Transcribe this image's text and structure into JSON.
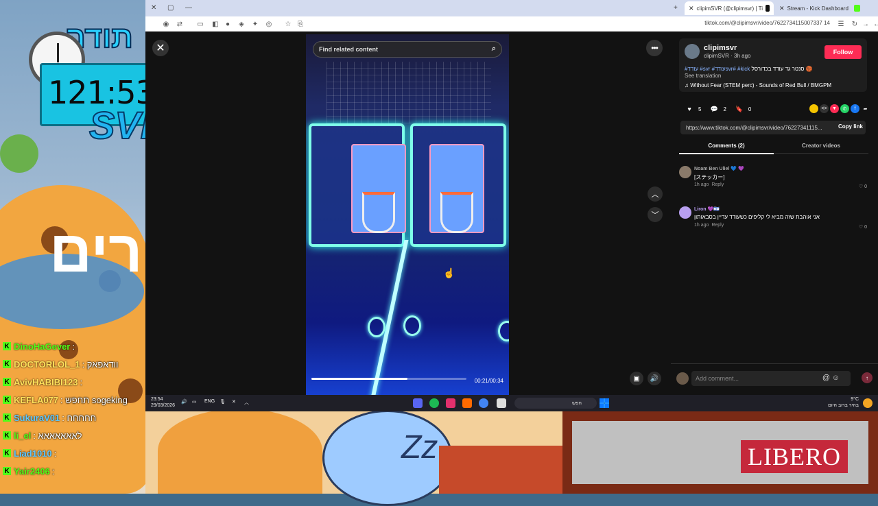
{
  "overlay": {
    "timer": "121:53",
    "logo_text": "SVR",
    "top_hebrew": "תודה",
    "big_hebrew": "רים",
    "libero_text": "LIBERO",
    "chat": [
      {
        "user": "DinoHaGever",
        "msg": ":",
        "color": "green"
      },
      {
        "user": "DOCTORLOL_1",
        "msg": ": וודאפאק",
        "color": "yellow"
      },
      {
        "user": "AvivHABIBI123",
        "msg": ":",
        "color": "yellow"
      },
      {
        "user": "KEFLA077",
        "msg": ": תחפש sogeking",
        "color": "yellow"
      },
      {
        "user": "SukuraV01",
        "msg": ": חחחחח",
        "color": "cyan"
      },
      {
        "user": "li_el",
        "msg": ": לאאאאאאא",
        "color": "green"
      },
      {
        "user": "Liad1010",
        "msg": ":",
        "color": "cyan"
      },
      {
        "user": "Yair2406",
        "msg": ":",
        "color": "green"
      }
    ]
  },
  "browser": {
    "tabs": [
      {
        "label": "clipimSVR (@clipimsvr) | Ti",
        "active": true
      },
      {
        "label": "Stream - Kick Dashboard",
        "active": false
      }
    ],
    "url": "tiktok.com/@clipimsvr/video/7622734115007337 14"
  },
  "video": {
    "search_placeholder": "Find related content",
    "time": "00:21/00:34",
    "progress": 0.62
  },
  "post": {
    "username": "clipimsvr",
    "meta": "clipimSVR · 3h ago",
    "follow_label": "Follow",
    "description": "סנטר גד עודד בכדורסל 🏀",
    "tags": "#עודד #svr #עודדsvr# #kick",
    "see_translation": "See translation",
    "music": "♫  Without Fear (STEM perc) - Sounds of Red Bull / BMGPM",
    "likes": "5",
    "comments_count": "2",
    "saves": "0",
    "link": "https://www.tiktok.com/@clipimsvr/video/76227341115...",
    "copy_link": "Copy link",
    "tab_comments": "Comments (2)",
    "tab_creator": "Creator videos"
  },
  "comments": [
    {
      "user": "Noam Ben Uliel 💙 💜",
      "text": "[ステッカー]",
      "time": "1h ago",
      "reply": "Reply",
      "likes": "0",
      "avatar_color": "#8a7a6a"
    },
    {
      "user": "Liron 💜🇮🇱",
      "text": "אני אוהבת שזה מביא לי קליפים כשעודד עדיין בסבאותון",
      "time": "1h ago",
      "reply": "Reply",
      "likes": "0",
      "avatar_color": "#b89ff0"
    }
  ],
  "add_comment_placeholder": "Add comment...",
  "taskbar": {
    "time": "23:54",
    "date": "29/03/2026",
    "lang": "ENG",
    "search": "חפש",
    "weather_temp": "9°C",
    "weather_desc": "בהיר ברוב היום"
  }
}
